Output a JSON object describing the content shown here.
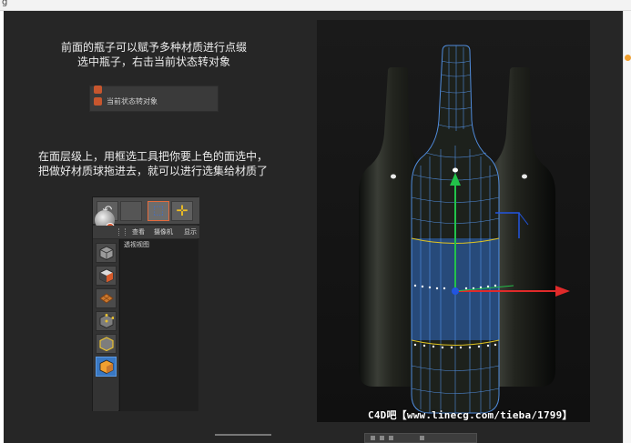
{
  "slide": {
    "caption_1": [
      "前面的瓶子可以赋予多种材质进行点缀",
      "选中瓶子，右击当前状态转对象"
    ],
    "caption_2": [
      "在面层级上，用框选工具把你要上色的面选中，",
      "把做好材质球拖进去，就可以进行选集给材质了"
    ],
    "context_menu": {
      "items": [
        {
          "label": "",
          "icon": "context-icon"
        },
        {
          "label": "当前状态转对象",
          "icon": "current-state-to-object-icon"
        }
      ]
    },
    "c4d_panel": {
      "toolbar": [
        {
          "icon": "undo-icon",
          "glyph": "↶"
        },
        {
          "icon": "blank-button-icon",
          "glyph": ""
        },
        {
          "icon": "select-tool-icon",
          "glyph": "⬚"
        },
        {
          "icon": "move-tool-icon",
          "glyph": "✛"
        }
      ],
      "menu": [
        "查看",
        "摄像机",
        "显示"
      ],
      "viewport_title": "透视视图",
      "palette": [
        "cube-icon",
        "checker-cube-icon",
        "grid-plane-icon",
        "points-mode-icon",
        "edges-mode-icon",
        "polygons-mode-icon"
      ]
    },
    "watermark": "C4D吧【www.linecg.com/tieba/1799】"
  },
  "colors": {
    "slide_bg": "#262626",
    "accent_blue": "#3a78c2",
    "selection_blue": "#2f6ec8",
    "selection_yellow": "#e0c320",
    "axis_red": "#e02a2a",
    "axis_green": "#22c24a",
    "axis_blue": "#2255e0"
  }
}
